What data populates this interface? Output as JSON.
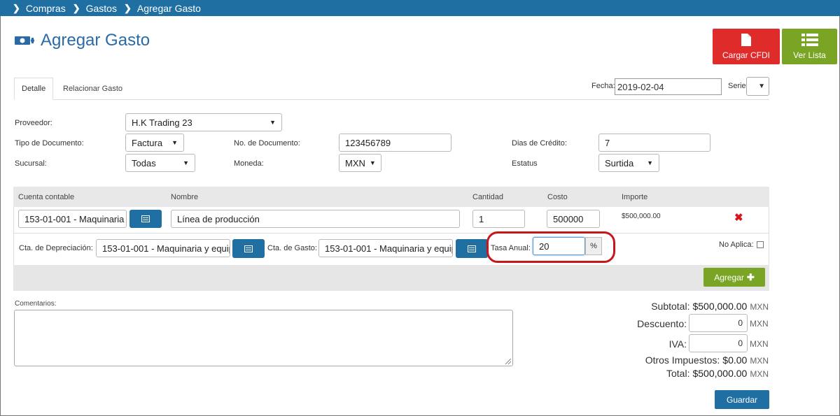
{
  "breadcrumb": [
    "Compras",
    "Gastos",
    "Agregar Gasto"
  ],
  "page_title": "Agregar Gasto",
  "actions": {
    "cargar_cfdi": "Cargar CFDI",
    "ver_lista": "Ver Lista"
  },
  "tabs": [
    "Detalle",
    "Relacionar Gasto"
  ],
  "fecha": {
    "label": "Fecha:",
    "value": "2019-02-04"
  },
  "serie": {
    "label": "Serie",
    "value": ""
  },
  "form": {
    "proveedor": {
      "label": "Proveedor:",
      "value": "H.K Trading 23"
    },
    "tipo_documento": {
      "label": "Tipo de Documento:",
      "value": "Factura"
    },
    "no_documento": {
      "label": "No. de Documento:",
      "value": "123456789"
    },
    "dias_credito": {
      "label": "Dias de Crédito:",
      "value": "7"
    },
    "sucursal": {
      "label": "Sucursal:",
      "value": "Todas"
    },
    "moneda": {
      "label": "Moneda:",
      "value": "MXN"
    },
    "estatus": {
      "label": "Estatus",
      "value": "Surtida"
    }
  },
  "table": {
    "headers": [
      "Cuenta contable",
      "Nombre",
      "Cantidad",
      "Costo",
      "Importe"
    ],
    "row": {
      "cuenta": "153-01-001 - Maquinaria y",
      "nombre": "Línea de producción",
      "cantidad": "1",
      "costo": "500000",
      "importe": "$500,000.00"
    },
    "detail": {
      "cta_depreciacion_label": "Cta. de Depreciación:",
      "cta_depreciacion_value": "153-01-001 - Maquinaria y equip",
      "cta_gasto_label": "Cta. de Gasto:",
      "cta_gasto_value": "153-01-001 - Maquinaria y equip",
      "tasa_anual_label": "Tasa Anual:",
      "tasa_anual_value": "20",
      "pct": "%",
      "no_aplica_label": "No Aplica:",
      "no_aplica_checked": false
    },
    "agregar": "Agregar"
  },
  "comentarios": {
    "label": "Comentarios:",
    "value": ""
  },
  "totals": {
    "subtotal_label": "Subtotal:",
    "subtotal_value": "$500,000.00",
    "descuento_label": "Descuento:",
    "descuento_value": "0",
    "iva_label": "IVA:",
    "iva_value": "0",
    "otros_label": "Otros Impuestos:",
    "otros_value": "$0.00",
    "total_label": "Total:",
    "total_value": "$500,000.00",
    "currency": "MXN"
  },
  "guardar": "Guardar",
  "colors": {
    "primary": "#1f6fa3",
    "danger": "#e02b2b",
    "success": "#7aa524",
    "highlight": "#c8161d"
  }
}
